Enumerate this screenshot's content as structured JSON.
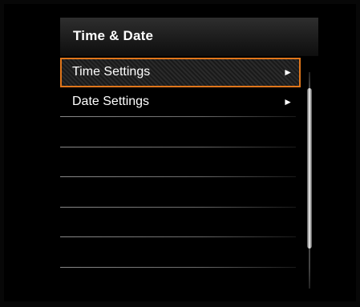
{
  "window": {
    "title": "Time & Date"
  },
  "menu": {
    "items": [
      {
        "label": "Time Settings",
        "arrow": "►",
        "selected": true
      },
      {
        "label": "Date Settings",
        "arrow": "►",
        "selected": false
      }
    ],
    "empty_rows": 5
  },
  "colors": {
    "selection_border": "#e0761b",
    "text": "#ffffff",
    "background": "#000000"
  },
  "icons": {
    "submenu_arrow": "right-triangle-icon"
  }
}
